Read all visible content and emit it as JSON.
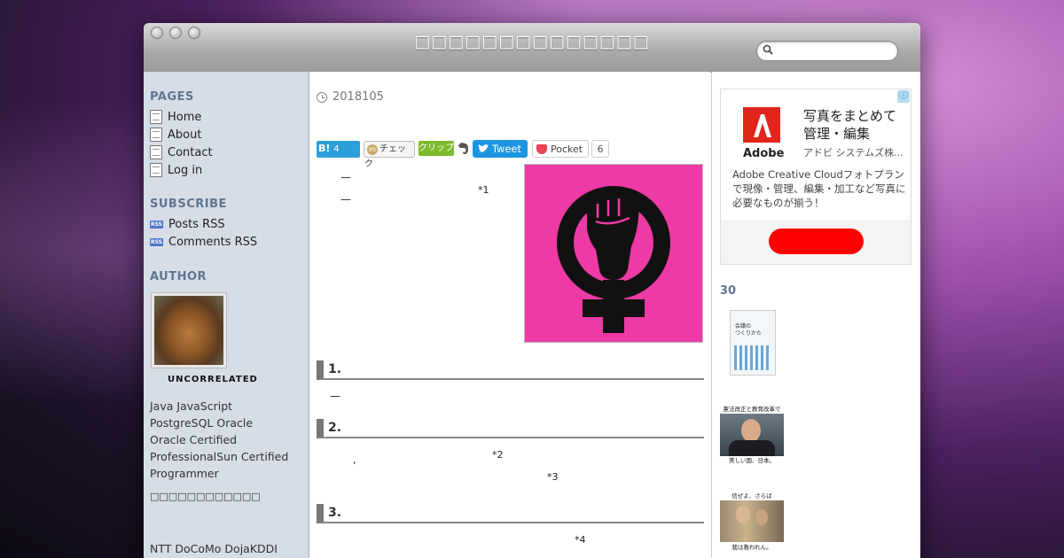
{
  "window": {
    "site_title": "□□□□□□□□□□□□□□",
    "search": {
      "placeholder": "",
      "icon": "search-icon"
    }
  },
  "sidebar": {
    "pages_heading": "PAGES",
    "pages": [
      {
        "label": "Home",
        "icon": "page-icon"
      },
      {
        "label": "About",
        "icon": "page-icon"
      },
      {
        "label": "Contact",
        "icon": "page-icon"
      },
      {
        "label": "Log in",
        "icon": "page-icon"
      }
    ],
    "subscribe_heading": "SUBSCRIBE",
    "feeds": [
      {
        "label": "Posts RSS",
        "icon": "rss-icon"
      },
      {
        "label": "Comments RSS",
        "icon": "rss-icon"
      }
    ],
    "rss_badge": "RSS",
    "author_heading": "AUTHOR",
    "author_name": "UNCORRELATED",
    "bio_lines": [
      "Java JavaScript",
      "PostgreSQL Oracle",
      "Oracle Certified",
      "ProfessionalSun Certified",
      "Programmer"
    ],
    "bio_extra": "□□□□□□□□□□□□",
    "bio_more": "NTT DoCoMo DojaKDDI"
  },
  "post": {
    "date": "2018105",
    "share": {
      "hatena_label": "B!",
      "hatena_count": "4",
      "check_label": "チェック",
      "clip_label": "クリップ",
      "tweet_label": "Tweet",
      "pocket_label": "Pocket",
      "pocket_count": "6"
    },
    "dashes": [
      "—",
      "—",
      "—"
    ],
    "footnotes": [
      "*1",
      "*2",
      "*3",
      "*4"
    ],
    "comma": ",",
    "headings": [
      "1.",
      "2.",
      "3."
    ]
  },
  "right_sidebar": {
    "ad": {
      "info_icon": "ⓘ",
      "brand_logo_text": "Adobe",
      "headline": "写真をまとめて管理・編集",
      "advertiser": "アドビ システムズ株...",
      "body": "Adobe Creative Cloudフォトプランで現像・管理、編集・加工など写真に必要なものが揃う！",
      "cta_label": ""
    },
    "section_heading": "30",
    "book_cover_text": {
      "title": "会議の\nつくりかた",
      "subtitle": ""
    },
    "thumb2_text": {
      "top": "憲法改正と教育改革で",
      "bottom": "美しい国、日本。"
    },
    "thumb3_text": {
      "top": "信ぜよ、さらば",
      "bottom": "我は救われん。"
    }
  },
  "colors": {
    "hatena": "#2c9fdb",
    "clip": "#7cbb2c",
    "tweet": "#1b95e0",
    "pocket": "#ee4056",
    "feminism_bg": "#ee3aa5",
    "sidebar_heading": "#5f7590",
    "ad_cta": "#ff0000"
  }
}
